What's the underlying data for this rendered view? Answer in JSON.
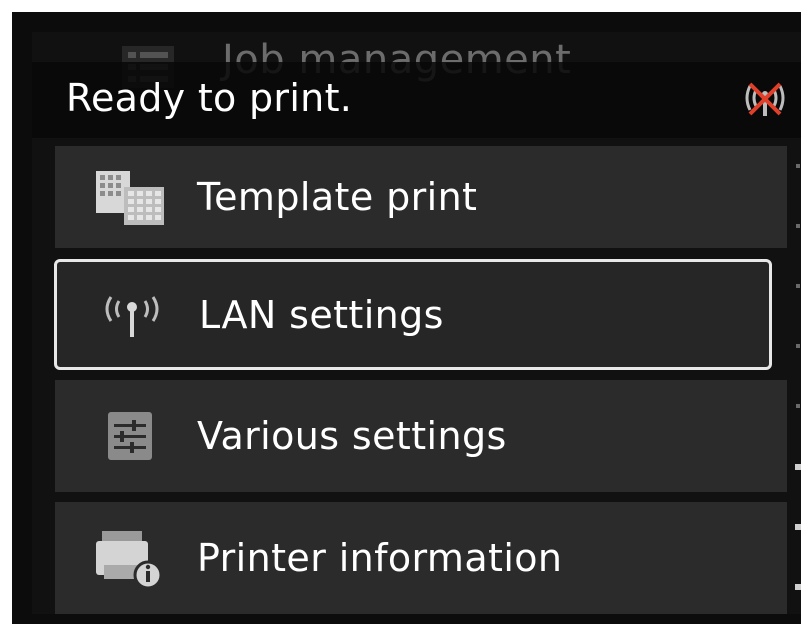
{
  "screen": {
    "status_text": "Ready to print.",
    "wireless_status_icon": "wifi-disabled-icon",
    "scrolled_item": {
      "label": "Job management",
      "icon": "list-icon"
    },
    "menu": [
      {
        "label": "Template print",
        "icon": "template-grid-icon",
        "selected": false
      },
      {
        "label": "LAN settings",
        "icon": "antenna-icon",
        "selected": true
      },
      {
        "label": "Various settings",
        "icon": "sliders-icon",
        "selected": false
      },
      {
        "label": "Printer information",
        "icon": "printer-info-icon",
        "selected": false
      }
    ],
    "colors": {
      "background": "#111111",
      "item": "#2b2b2b",
      "text": "#ffffff",
      "selection_border": "#e8e8e8",
      "wifi_cross": "#e0402a"
    }
  }
}
